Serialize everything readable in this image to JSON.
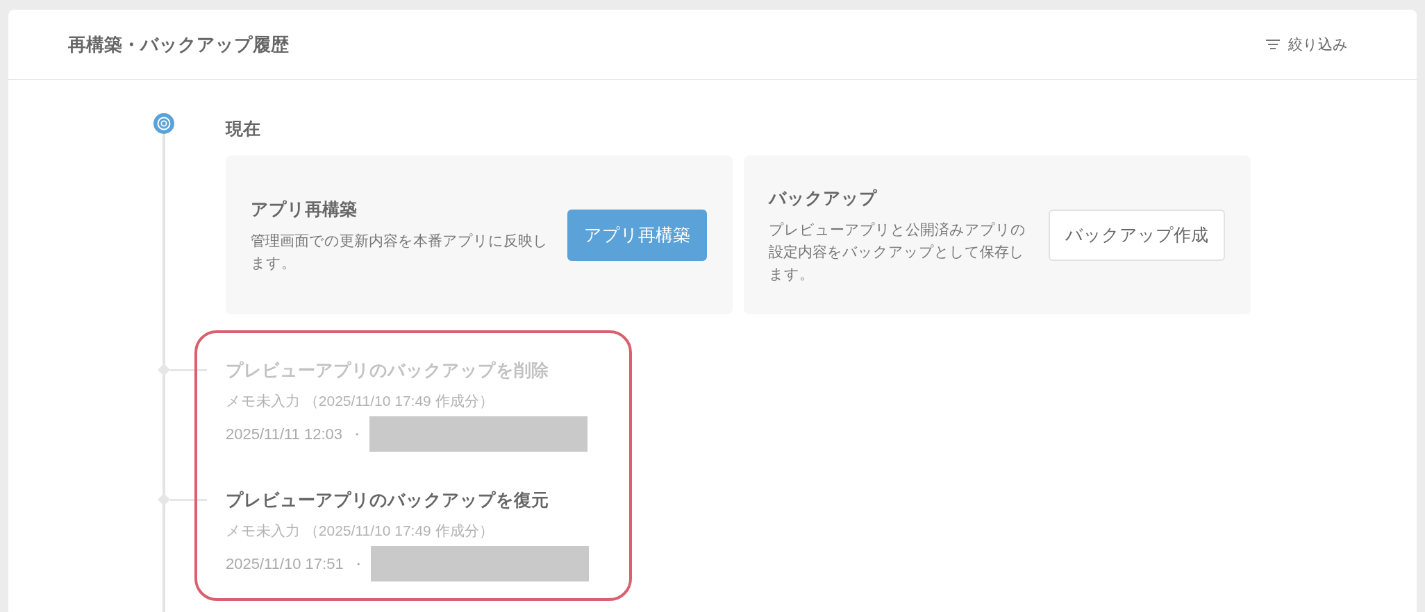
{
  "header": {
    "title": "再構築・バックアップ履歴",
    "filter_button": {
      "label": "絞り込み"
    }
  },
  "timeline": {
    "current": {
      "label": "現在",
      "actions": [
        {
          "title": "アプリ再構築",
          "description": "管理画面での更新内容を本番アプリに反映します。",
          "button": {
            "label": "アプリ再構築",
            "kind": "primary"
          }
        },
        {
          "title": "バックアップ",
          "description": "プレビューアプリと公開済みアプリの設定内容をバックアップとして保存します。",
          "button": {
            "label": "バックアップ作成",
            "kind": "secondary"
          }
        }
      ]
    },
    "history": {
      "highlighted": true,
      "entries": [
        {
          "title": "プレビューアプリのバックアップを削除",
          "disabled": true,
          "memo": "メモ未入力 （2025/11/10 17:49 作成分）",
          "timestamp": "2025/11/11 12:03",
          "separator": "・",
          "user_redacted": true
        },
        {
          "title": "プレビューアプリのバックアップを復元",
          "disabled": false,
          "memo": "メモ未入力 （2025/11/10 17:49 作成分）",
          "timestamp": "2025/11/10 17:51",
          "separator": "・",
          "user_redacted": true
        }
      ]
    }
  }
}
